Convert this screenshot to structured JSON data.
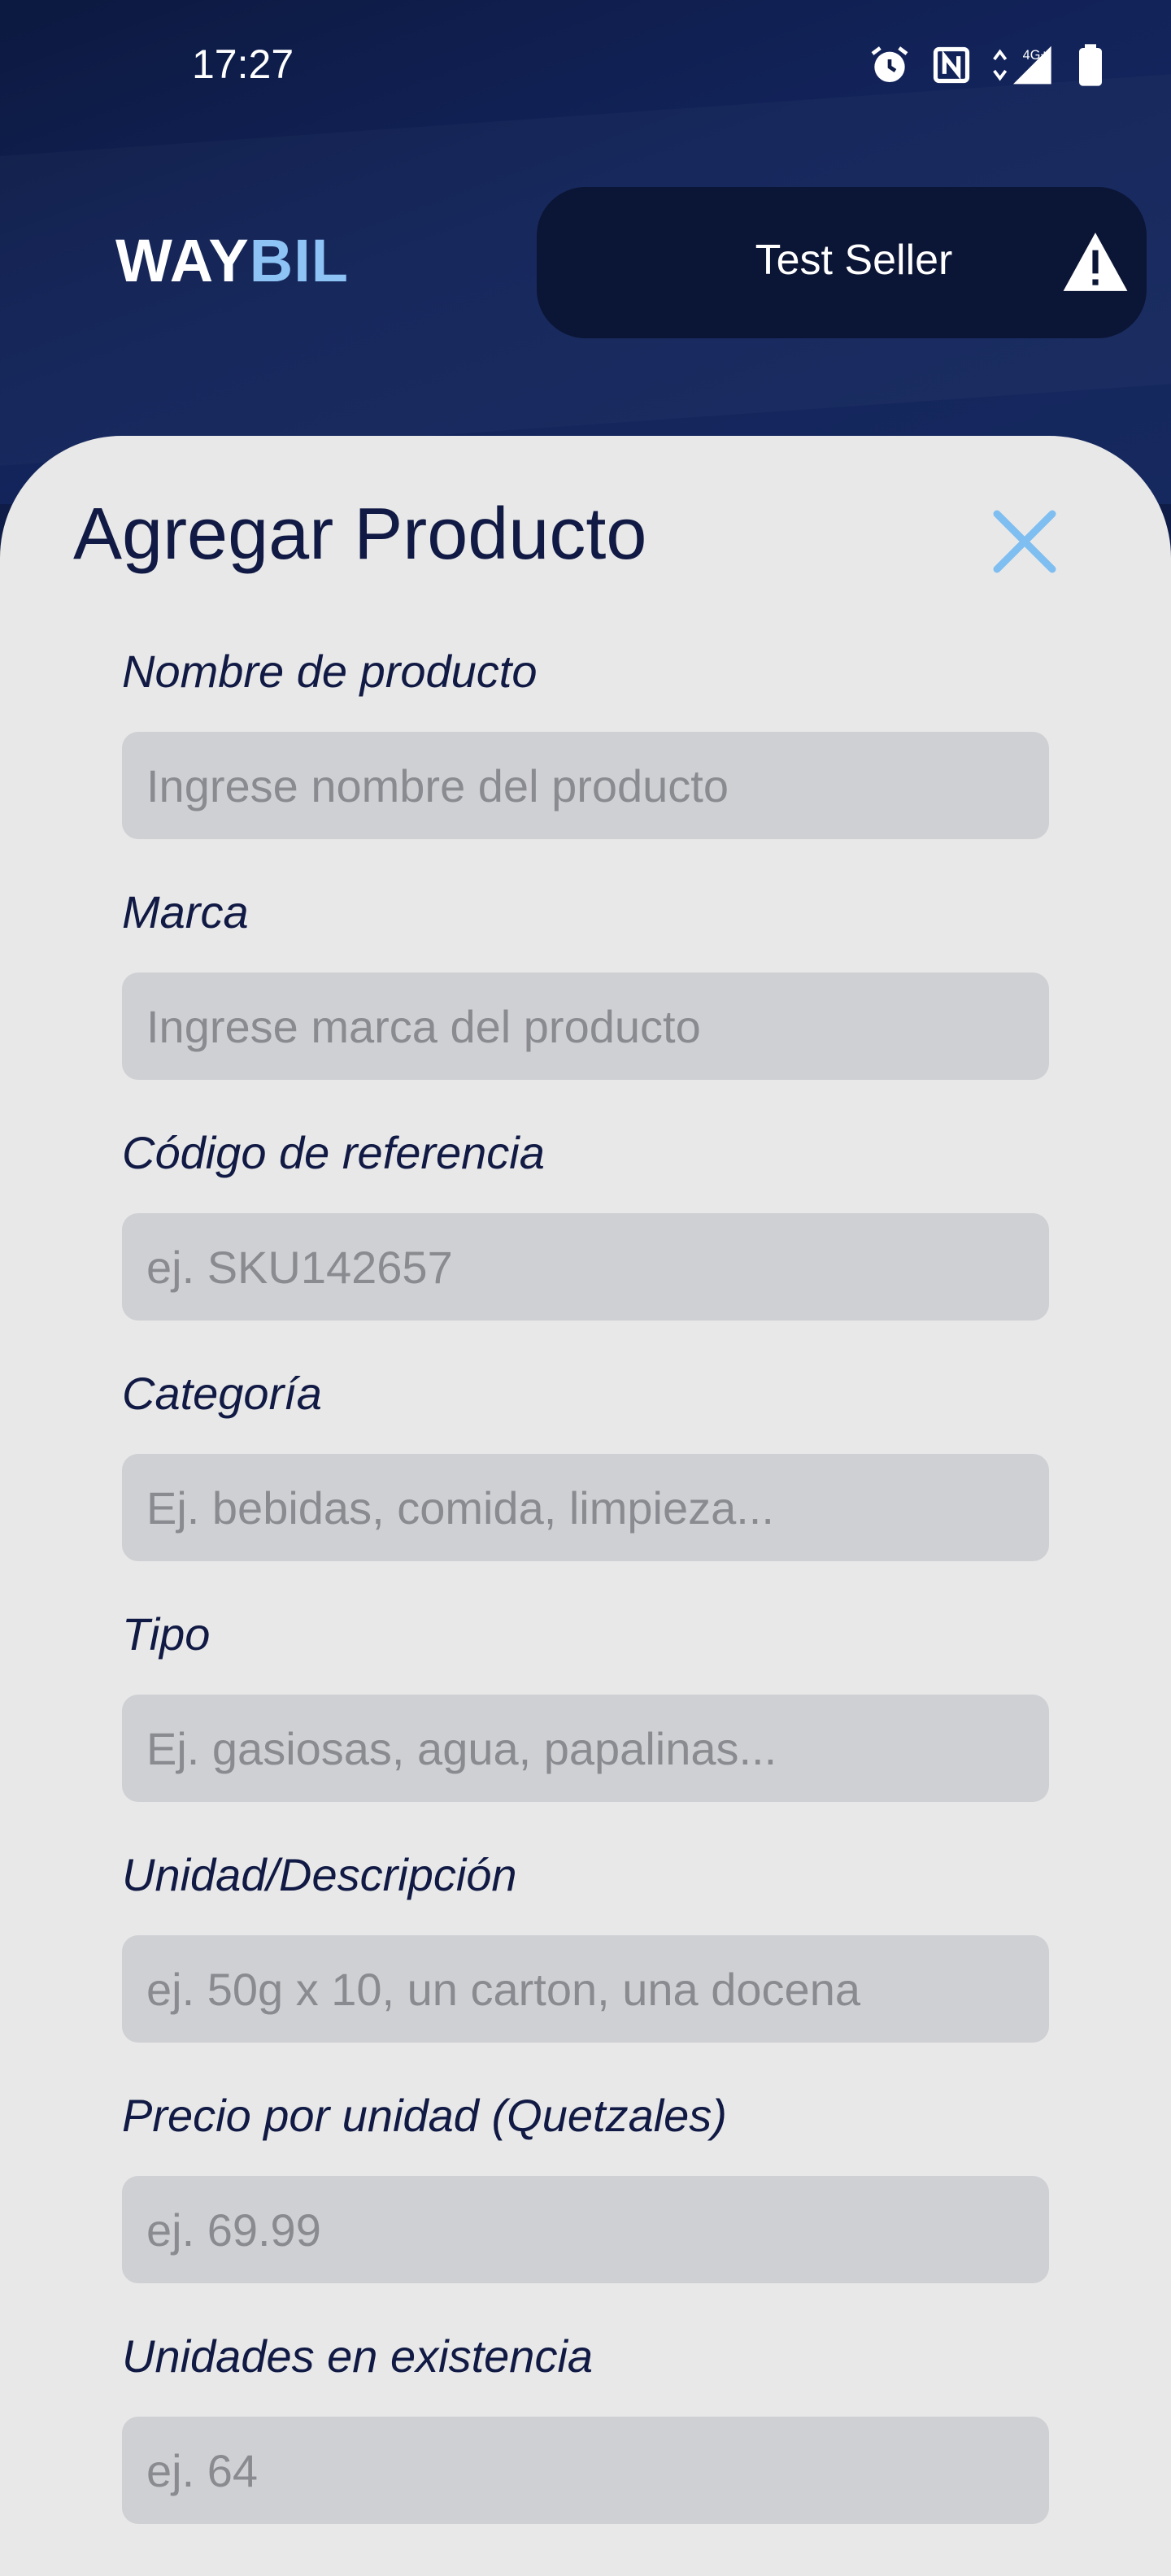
{
  "status_bar": {
    "time": "17:27",
    "network_label": "4G+"
  },
  "header": {
    "brand_part1": "WAY",
    "brand_part2": "BIL",
    "seller_name": "Test Seller"
  },
  "sheet": {
    "title": "Agregar Producto"
  },
  "fields": [
    {
      "label": "Nombre de producto",
      "placeholder": "Ingrese nombre del producto",
      "value": ""
    },
    {
      "label": "Marca",
      "placeholder": "Ingrese marca del producto",
      "value": ""
    },
    {
      "label": "Código de referencia",
      "placeholder": "ej. SKU142657",
      "value": ""
    },
    {
      "label": "Categoría",
      "placeholder": "Ej. bebidas, comida, limpieza...",
      "value": ""
    },
    {
      "label": "Tipo",
      "placeholder": "Ej. gasiosas, agua, papalinas...",
      "value": ""
    },
    {
      "label": "Unidad/Descripción",
      "placeholder": "ej. 50g x 10, un carton, una docena",
      "value": ""
    },
    {
      "label": "Precio por unidad (Quetzales)",
      "placeholder": "ej. 69.99",
      "value": ""
    },
    {
      "label": "Unidades en existencia",
      "placeholder": "ej. 64",
      "value": ""
    }
  ],
  "colors": {
    "header_bg": "#0f1c48",
    "brand_accent": "#8dc3f5",
    "sheet_bg": "#e8e8e8",
    "input_bg": "#cfd0d4",
    "text_dark": "#111a44"
  }
}
